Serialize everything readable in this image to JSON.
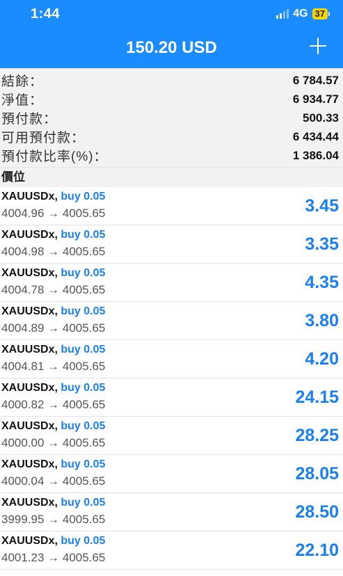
{
  "status_bar": {
    "time": "1:44",
    "network": "4G",
    "battery": "37"
  },
  "header": {
    "title": "150.20 USD",
    "add_icon": "plus-icon"
  },
  "summary": [
    {
      "label": "結餘：",
      "value": "6 784.57"
    },
    {
      "label": "淨值：",
      "value": "6 934.77"
    },
    {
      "label": "預付款：",
      "value": "500.33"
    },
    {
      "label": "可用預付款：",
      "value": "6 434.44"
    },
    {
      "label": "預付款比率(%)：",
      "value": "1 386.04"
    }
  ],
  "section_title": "價位",
  "positions": [
    {
      "symbol": "XAUUSDx,",
      "side": "buy 0.05",
      "prices": "4004.96 → 4005.65",
      "profit": "3.45"
    },
    {
      "symbol": "XAUUSDx,",
      "side": "buy 0.05",
      "prices": "4004.98 → 4005.65",
      "profit": "3.35"
    },
    {
      "symbol": "XAUUSDx,",
      "side": "buy 0.05",
      "prices": "4004.78 → 4005.65",
      "profit": "4.35"
    },
    {
      "symbol": "XAUUSDx,",
      "side": "buy 0.05",
      "prices": "4004.89 → 4005.65",
      "profit": "3.80"
    },
    {
      "symbol": "XAUUSDx,",
      "side": "buy 0.05",
      "prices": "4004.81 → 4005.65",
      "profit": "4.20"
    },
    {
      "symbol": "XAUUSDx,",
      "side": "buy 0.05",
      "prices": "4000.82 → 4005.65",
      "profit": "24.15"
    },
    {
      "symbol": "XAUUSDx,",
      "side": "buy 0.05",
      "prices": "4000.00 → 4005.65",
      "profit": "28.25"
    },
    {
      "symbol": "XAUUSDx,",
      "side": "buy 0.05",
      "prices": "4000.04 → 4005.65",
      "profit": "28.05"
    },
    {
      "symbol": "XAUUSDx,",
      "side": "buy 0.05",
      "prices": "3999.95 → 4005.65",
      "profit": "28.50"
    },
    {
      "symbol": "XAUUSDx,",
      "side": "buy 0.05",
      "prices": "4001.23 → 4005.65",
      "profit": "22.10"
    }
  ],
  "colors": {
    "header_bg": "#1a8cff",
    "accent_blue": "#1a7ff0",
    "battery": "#f5d400",
    "summary_bg": "#f2f2f2"
  }
}
